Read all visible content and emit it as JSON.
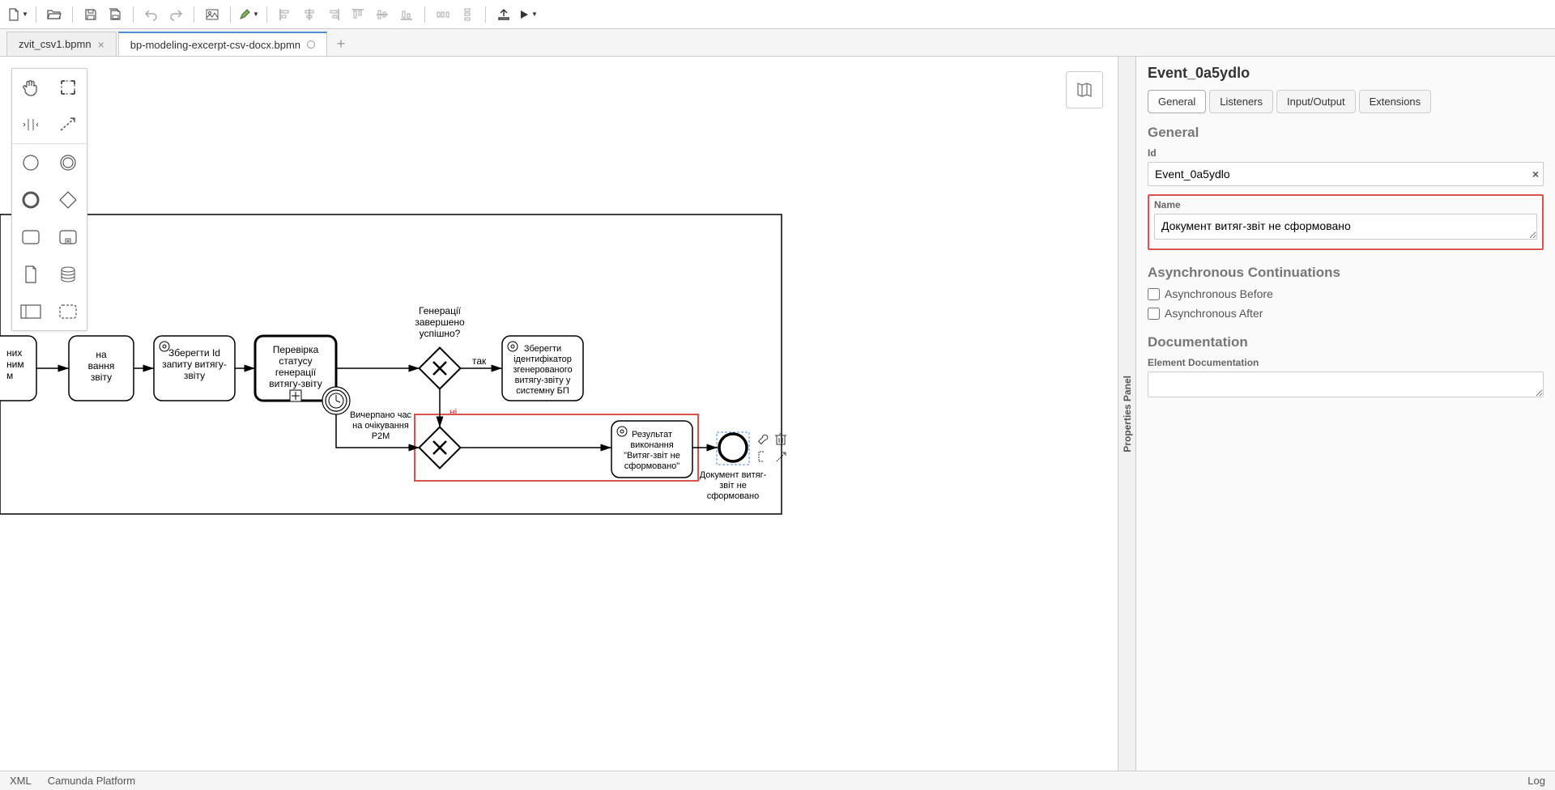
{
  "toolbar": {
    "icons": [
      "new-file",
      "open",
      "save",
      "save-all",
      "undo",
      "redo",
      "image",
      "highlight",
      "align-left",
      "align-center",
      "align-right",
      "dist-h",
      "dist-v",
      "dist-c",
      "align-top",
      "align-bottom",
      "deploy",
      "run"
    ]
  },
  "tabs": [
    {
      "label": "zvit_csv1.bpmn",
      "active": false,
      "dirty": false
    },
    {
      "label": "bp-modeling-excerpt-csv-docx.bpmn",
      "active": true,
      "dirty": true
    }
  ],
  "bpmn": {
    "task_edge_left": "них\nним\nм",
    "task_request": "на\nвання\nзвіту",
    "task_save_id": "Зберегти Id\nзапиту витягу-\nзвіту",
    "task_check_status": "Перевірка\nстатусу\nгенерації\nвитягу-звіту",
    "gateway_label": "Генерації\nзавершено\nуспішно?",
    "yes": "так",
    "no": "ні",
    "timer_label": "Вичерпано час\nна очікування\nP2M",
    "task_save_identifier": "Зберегти\nідентифікатор\nзгенерованого\nвитягу-звіту у\nсистемну БП",
    "task_result": "Результат\nвиконання\n\"Витяг-звіт не\nсформовано\"",
    "end_event_label": "Документ витяг-\nзвіт не\nсформовано"
  },
  "properties": {
    "panel_title": "Properties Panel",
    "element_title": "Event_0a5ydlo",
    "tabs": [
      "General",
      "Listeners",
      "Input/Output",
      "Extensions"
    ],
    "active_tab": "General",
    "section_general": "General",
    "id_label": "Id",
    "id_value": "Event_0a5ydlo",
    "name_label": "Name",
    "name_value": "Документ витяг-звіт не сформовано",
    "section_async": "Asynchronous Continuations",
    "async_before": "Asynchronous Before",
    "async_after": "Asynchronous After",
    "section_doc": "Documentation",
    "doc_label": "Element Documentation",
    "doc_value": ""
  },
  "status_bar": {
    "xml": "XML",
    "platform": "Camunda Platform",
    "log": "Log"
  }
}
